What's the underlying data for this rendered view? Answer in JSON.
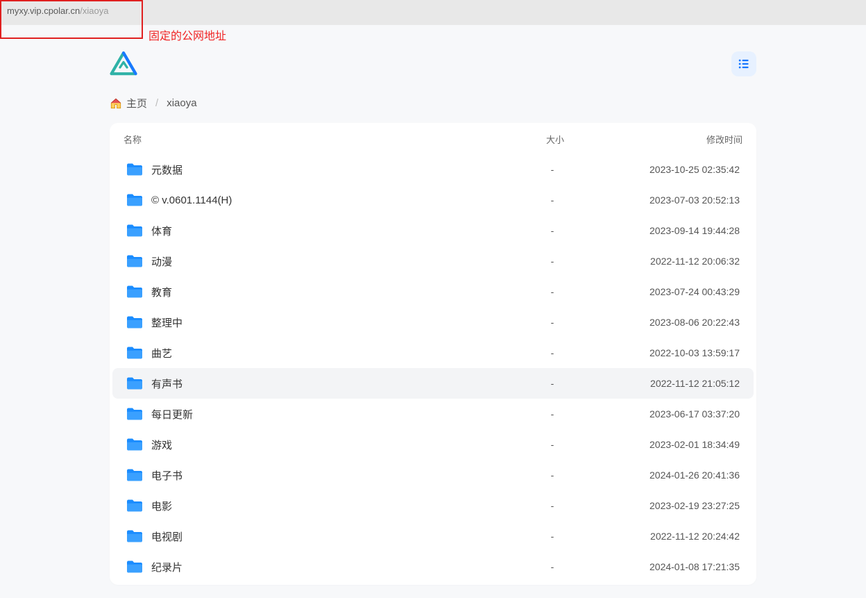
{
  "address_bar": {
    "host": "myxy.vip.cpolar.cn",
    "path": "/xiaoya"
  },
  "annotation": "固定的公网地址",
  "breadcrumb": {
    "home_label": "主页",
    "separator": "/",
    "crumbs": [
      {
        "label": "xiaoya"
      }
    ]
  },
  "columns": {
    "name": "名称",
    "size": "大小",
    "time": "修改时间"
  },
  "hovered_index": 7,
  "rows": [
    {
      "name": "元数据",
      "size": "-",
      "time": "2023-10-25 02:35:42"
    },
    {
      "name": "© v.0601.1144(H)",
      "size": "-",
      "time": "2023-07-03 20:52:13"
    },
    {
      "name": "体育",
      "size": "-",
      "time": "2023-09-14 19:44:28"
    },
    {
      "name": "动漫",
      "size": "-",
      "time": "2022-11-12 20:06:32"
    },
    {
      "name": "教育",
      "size": "-",
      "time": "2023-07-24 00:43:29"
    },
    {
      "name": "整理中",
      "size": "-",
      "time": "2023-08-06 20:22:43"
    },
    {
      "name": "曲艺",
      "size": "-",
      "time": "2022-10-03 13:59:17"
    },
    {
      "name": "有声书",
      "size": "-",
      "time": "2022-11-12 21:05:12"
    },
    {
      "name": "每日更新",
      "size": "-",
      "time": "2023-06-17 03:37:20"
    },
    {
      "name": "游戏",
      "size": "-",
      "time": "2023-02-01 18:34:49"
    },
    {
      "name": "电子书",
      "size": "-",
      "time": "2024-01-26 20:41:36"
    },
    {
      "name": "电影",
      "size": "-",
      "time": "2023-02-19 23:27:25"
    },
    {
      "name": "电视剧",
      "size": "-",
      "time": "2022-11-12 20:24:42"
    },
    {
      "name": "纪录片",
      "size": "-",
      "time": "2024-01-08 17:21:35"
    }
  ]
}
